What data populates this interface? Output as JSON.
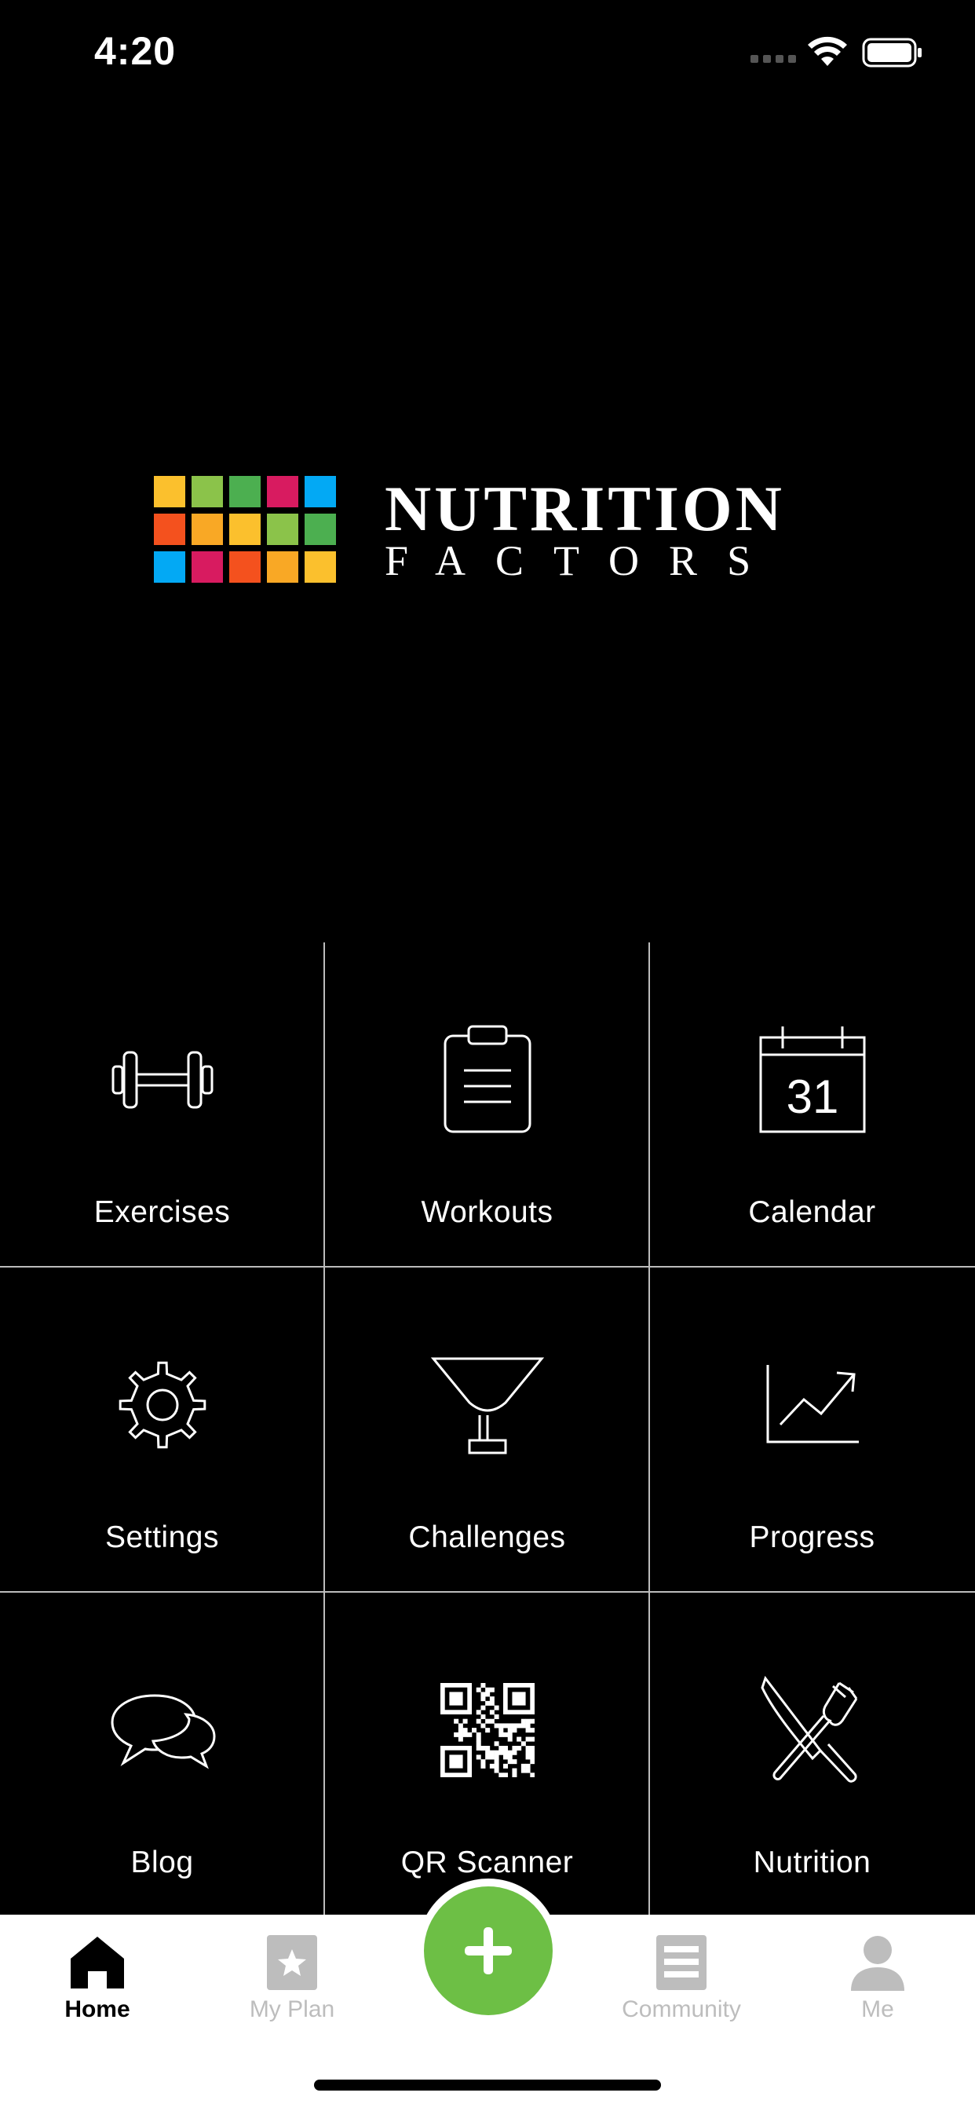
{
  "status_bar": {
    "time": "4:20"
  },
  "brand": {
    "line1": "NUTRITION",
    "line2": "FACTORS"
  },
  "logo_colors": [
    "#fbc02d",
    "#8bc34a",
    "#4caf50",
    "#d81b60",
    "#03a9f4",
    "#f4511e",
    "#f9a825",
    "#fbc02d",
    "#8bc34a",
    "#4caf50",
    "#03a9f4",
    "#d81b60",
    "#f4511e",
    "#f9a825",
    "#fbc02d"
  ],
  "tiles": [
    {
      "label": "Exercises",
      "icon": "dumbbell-icon"
    },
    {
      "label": "Workouts",
      "icon": "clipboard-icon"
    },
    {
      "label": "Calendar",
      "icon": "calendar-icon",
      "day": "31"
    },
    {
      "label": "Settings",
      "icon": "gear-icon"
    },
    {
      "label": "Challenges",
      "icon": "trophy-icon"
    },
    {
      "label": "Progress",
      "icon": "chart-up-icon"
    },
    {
      "label": "Blog",
      "icon": "chat-bubbles-icon"
    },
    {
      "label": "QR Scanner",
      "icon": "qr-code-icon"
    },
    {
      "label": "Nutrition",
      "icon": "fork-knife-icon"
    }
  ],
  "tabbar": {
    "items": [
      {
        "label": "Home",
        "icon": "home-icon",
        "active": true
      },
      {
        "label": "My Plan",
        "icon": "star-icon",
        "active": false
      },
      {
        "label": "Community",
        "icon": "community-icon",
        "active": false
      },
      {
        "label": "Me",
        "icon": "person-icon",
        "active": false
      }
    ],
    "fab_icon": "plus-icon"
  },
  "colors": {
    "accent": "#6dbf45",
    "background": "#000000",
    "tab_inactive": "#bdbdbd"
  }
}
